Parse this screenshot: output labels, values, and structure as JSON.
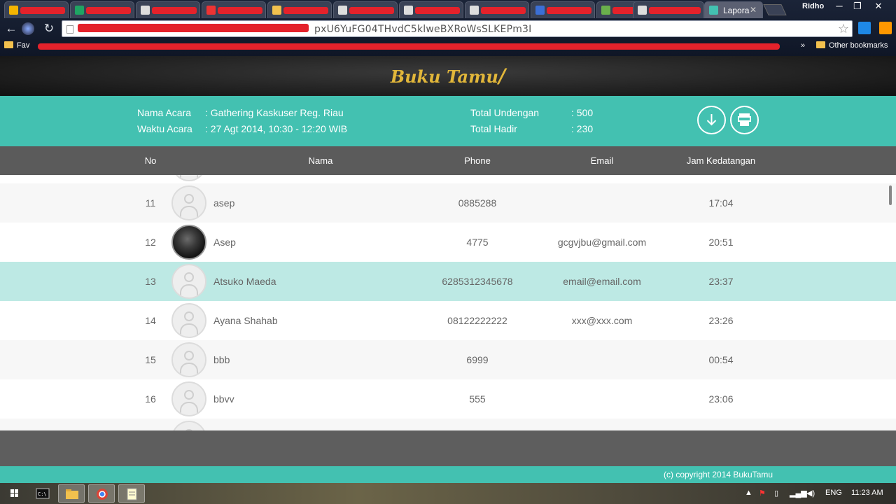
{
  "browser": {
    "active_tab_title": "Lapora",
    "user_name": "Ridho",
    "url_visible": "pxU6YuFG04THvdC5klweBXRoWsSLKEPm3I",
    "bookmarks": {
      "first": "Fav",
      "last": "Other bookmarks"
    }
  },
  "app": {
    "logo": "Buku Tamu"
  },
  "event": {
    "name_label": "Nama Acara",
    "name_value": ": Gathering Kaskuser Reg. Riau",
    "time_label": "Waktu Acara",
    "time_value": ": 27 Agt 2014, 10:30 - 12:20 WIB",
    "invited_label": "Total Undengan",
    "invited_value": ": 500",
    "present_label": "Total Hadir",
    "present_value": ": 230"
  },
  "table": {
    "headers": {
      "no": "No",
      "nama": "Nama",
      "phone": "Phone",
      "email": "Email",
      "jam": "Jam Kedatangan"
    },
    "rows": [
      {
        "no": "11",
        "nama": "asep",
        "phone": "0885288",
        "email": "",
        "jam": "17:04"
      },
      {
        "no": "12",
        "nama": "Asep",
        "phone": "4775",
        "email": "gcgvjbu@gmail.com",
        "jam": "20:51"
      },
      {
        "no": "13",
        "nama": "Atsuko Maeda",
        "phone": "6285312345678",
        "email": "email@email.com",
        "jam": "23:37"
      },
      {
        "no": "14",
        "nama": "Ayana Shahab",
        "phone": "08122222222",
        "email": "xxx@xxx.com",
        "jam": "23:26"
      },
      {
        "no": "15",
        "nama": "bbb",
        "phone": "6999",
        "email": "",
        "jam": "00:54"
      },
      {
        "no": "16",
        "nama": "bbvv",
        "phone": "555",
        "email": "",
        "jam": "23:06"
      }
    ]
  },
  "footer": {
    "copyright": "(c) copyright 2014 BukuTamu"
  },
  "taskbar": {
    "language": "ENG",
    "time": "11:23 AM"
  },
  "colors": {
    "teal": "#43c1b1",
    "highlight_row": "#bde9e4",
    "header_gray": "#5b5b5b",
    "logo_gold": "#e2b73a"
  }
}
